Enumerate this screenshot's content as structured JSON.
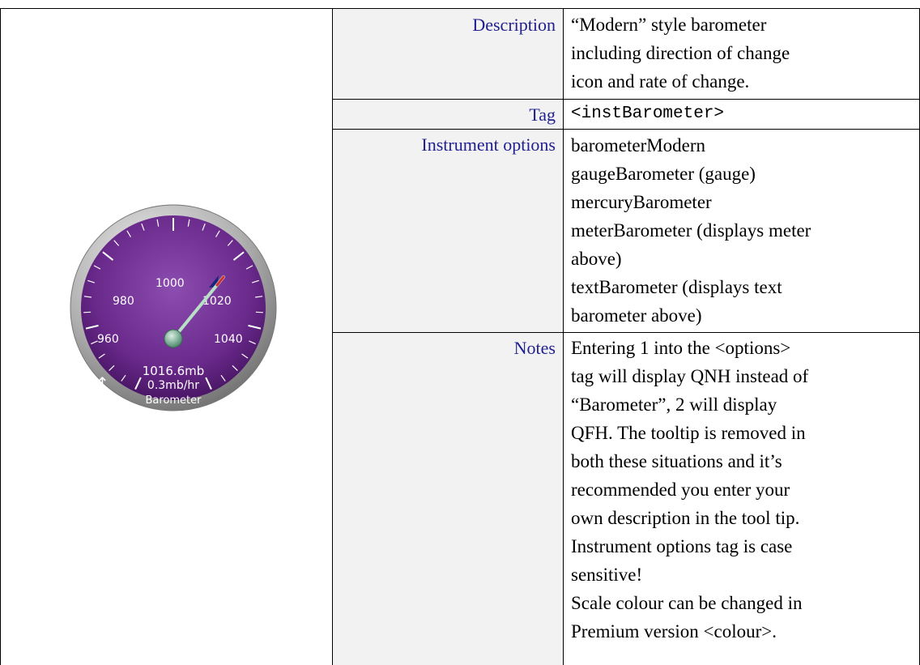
{
  "rows": [
    {
      "label": "Description",
      "lines": [
        "“Modern” style barometer",
        "including direction of change",
        "icon and rate of change."
      ]
    },
    {
      "label": "Tag",
      "lines": [
        "<instBarometer>"
      ]
    },
    {
      "label": "Instrument options",
      "lines": [
        "barometerModern",
        "gaugeBarometer (gauge)",
        "mercuryBarometer",
        "meterBarometer (displays meter",
        "above)",
        "textBarometer  (displays text",
        "barometer above)"
      ]
    },
    {
      "label": "Notes",
      "lines": [
        "Entering 1 into the <options>",
        "tag will display QNH instead of",
        "“Barometer”, 2 will display",
        "QFH. The tooltip is removed in",
        "both these situations and it’s",
        "recommended you enter your",
        "own description in the tool tip.",
        "Instrument options tag is case",
        "sensitive!",
        "Scale colour can be changed in",
        "Premium version <colour>."
      ]
    }
  ],
  "gauge": {
    "scale_labels": [
      "960",
      "980",
      "1000",
      "1020",
      "1040"
    ],
    "pressure": "1016.6mb",
    "rate": "0.3mb/hr",
    "caption": "Barometer",
    "trend_icon": "up-arrow-icon",
    "face_color": "#6a2a8c",
    "rim_color": "#9a9a9a"
  }
}
